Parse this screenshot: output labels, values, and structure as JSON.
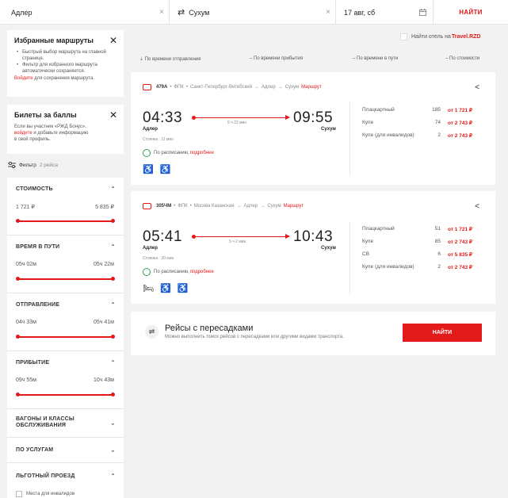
{
  "search": {
    "from": "Адлер",
    "to": "Сухум",
    "date": "17 авг, сб",
    "find_label": "НАЙТИ",
    "clear_glyph": "×",
    "swap_glyph": "⇄"
  },
  "favorites": {
    "title": "Избранные маршруты",
    "bullets": [
      "Быстрый выбор маршрута на главной странице.",
      "Фильтр для избранного маршрута автоматически сохраняется."
    ],
    "login_link": "Войдите",
    "login_rest": " для сохранения маршрута."
  },
  "bonus": {
    "title": "Билеты за баллы",
    "line1": "Если вы участник «РЖД Бонус»,",
    "login_link": "войдите",
    "line2_rest": " и добавьте информацию",
    "line3": "в свой профиль."
  },
  "filter": {
    "label": "Фильтр",
    "count": "2 рейса"
  },
  "filters": [
    {
      "title": "СТОИМОСТЬ",
      "min": "1 721 ₽",
      "max": "5 835 ₽",
      "expanded": true
    },
    {
      "title": "ВРЕМЯ В ПУТИ",
      "min": "05ч 02м",
      "max": "05ч 22м",
      "expanded": true
    },
    {
      "title": "ОТПРАВЛЕНИЕ",
      "min": "04ч 33м",
      "max": "05ч 41м",
      "expanded": true
    },
    {
      "title": "ПРИБЫТИЕ",
      "min": "09ч 55м",
      "max": "10ч 43м",
      "expanded": true
    },
    {
      "title": "ВАГОНЫ И КЛАССЫ ОБСЛУЖИВАНИЯ",
      "expanded": false
    },
    {
      "title": "ПО УСЛУГАМ",
      "expanded": false
    },
    {
      "title": "ЛЬГОТНЫЙ ПРОЕЗД",
      "expanded": true
    }
  ],
  "filter_preferential_option": "Места для инвалидов",
  "hotel": {
    "label": "Найти отель на ",
    "brand": "Travel.RZD"
  },
  "sort": [
    {
      "label": "По времени отправления",
      "active": true
    },
    {
      "label": "По времени прибытия",
      "active": false
    },
    {
      "label": "По времени в пути",
      "active": false
    },
    {
      "label": "По стоимости",
      "active": false
    }
  ],
  "trains": [
    {
      "number": "479А",
      "carrier": "ФПК",
      "route_text": "Санкт-Петербург-Витебский",
      "from_station": "Адлер",
      "to_station": "Сухум",
      "route_link": "Маршрут",
      "dep_time": "04:33",
      "arr_time": "09:55",
      "duration": "5 ч 22 мин",
      "stop_info": "Стоянка : 11 мин",
      "schedule_text": "По расписанию,",
      "schedule_link": "подробнее",
      "classes": [
        {
          "name": "Плацкартный",
          "seats": "185",
          "price": "от 1 721 ₽"
        },
        {
          "name": "Купе",
          "seats": "74",
          "price": "от 2 743 ₽"
        },
        {
          "name": "Купе (для инвалидов)",
          "seats": "2",
          "price": "от 2 743 ₽"
        }
      ]
    },
    {
      "number": "305ЧМ",
      "carrier": "ФПК",
      "route_text": "Москва Казанская",
      "from_station": "Адлер",
      "to_station": "Сухум",
      "route_link": "Маршрут",
      "dep_time": "05:41",
      "arr_time": "10:43",
      "duration": "5 ч 2 мин",
      "stop_info": "Стоянка : 20 мин",
      "schedule_text": "По расписанию,",
      "schedule_link": "подробнее",
      "classes": [
        {
          "name": "Плацкартный",
          "seats": "51",
          "price": "от 1 721 ₽"
        },
        {
          "name": "Купе",
          "seats": "85",
          "price": "от 2 743 ₽"
        },
        {
          "name": "СВ",
          "seats": "6",
          "price": "от 5 835 ₽"
        },
        {
          "name": "Купе (для инвалидов)",
          "seats": "2",
          "price": "от 2 743 ₽"
        }
      ]
    }
  ],
  "transfers": {
    "title": "Рейсы с пересадками",
    "subtitle": "Можно выполнить поиск рейсов с пересадками или другими видами транспорта.",
    "button": "НАЙТИ"
  },
  "colors": {
    "accent": "#e21a1a",
    "ok": "#2aa54a"
  }
}
